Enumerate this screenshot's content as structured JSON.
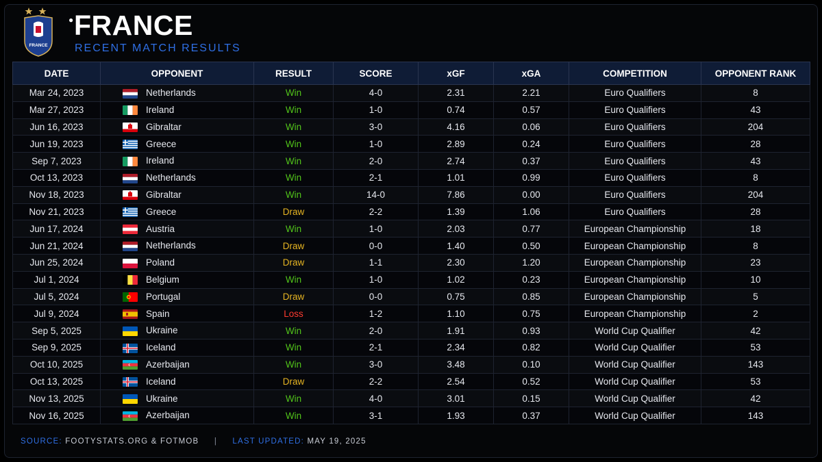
{
  "header": {
    "title": "FRANCE",
    "subtitle": "RECENT MATCH RESULTS",
    "crest_text": "FRANCE",
    "crest_stars": 2
  },
  "columns": [
    "DATE",
    "OPPONENT",
    "RESULT",
    "SCORE",
    "xGF",
    "xGA",
    "COMPETITION",
    "OPPONENT RANK"
  ],
  "rows": [
    {
      "date": "Mar 24, 2023",
      "opponent": "Netherlands",
      "flag": "netherlands-flag-icon",
      "result": "Win",
      "score": "4-0",
      "xgf": "2.31",
      "xga": "2.21",
      "competition": "Euro Qualifiers",
      "rank": "8"
    },
    {
      "date": "Mar 27, 2023",
      "opponent": "Ireland",
      "flag": "ireland-flag-icon",
      "result": "Win",
      "score": "1-0",
      "xgf": "0.74",
      "xga": "0.57",
      "competition": "Euro Qualifiers",
      "rank": "43"
    },
    {
      "date": "Jun 16, 2023",
      "opponent": "Gibraltar",
      "flag": "gibraltar-flag-icon",
      "result": "Win",
      "score": "3-0",
      "xgf": "4.16",
      "xga": "0.06",
      "competition": "Euro Qualifiers",
      "rank": "204"
    },
    {
      "date": "Jun 19, 2023",
      "opponent": "Greece",
      "flag": "greece-flag-icon",
      "result": "Win",
      "score": "1-0",
      "xgf": "2.89",
      "xga": "0.24",
      "competition": "Euro Qualifiers",
      "rank": "28"
    },
    {
      "date": "Sep 7, 2023",
      "opponent": "Ireland",
      "flag": "ireland-flag-icon",
      "result": "Win",
      "score": "2-0",
      "xgf": "2.74",
      "xga": "0.37",
      "competition": "Euro Qualifiers",
      "rank": "43"
    },
    {
      "date": "Oct 13, 2023",
      "opponent": "Netherlands",
      "flag": "netherlands-flag-icon",
      "result": "Win",
      "score": "2-1",
      "xgf": "1.01",
      "xga": "0.99",
      "competition": "Euro Qualifiers",
      "rank": "8"
    },
    {
      "date": "Nov 18, 2023",
      "opponent": "Gibraltar",
      "flag": "gibraltar-flag-icon",
      "result": "Win",
      "score": "14-0",
      "xgf": "7.86",
      "xga": "0.00",
      "competition": "Euro Qualifiers",
      "rank": "204"
    },
    {
      "date": "Nov 21, 2023",
      "opponent": "Greece",
      "flag": "greece-flag-icon",
      "result": "Draw",
      "score": "2-2",
      "xgf": "1.39",
      "xga": "1.06",
      "competition": "Euro Qualifiers",
      "rank": "28"
    },
    {
      "date": "Jun 17, 2024",
      "opponent": "Austria",
      "flag": "austria-flag-icon",
      "result": "Win",
      "score": "1-0",
      "xgf": "2.03",
      "xga": "0.77",
      "competition": "European Championship",
      "rank": "18"
    },
    {
      "date": "Jun 21, 2024",
      "opponent": "Netherlands",
      "flag": "netherlands-flag-icon",
      "result": "Draw",
      "score": "0-0",
      "xgf": "1.40",
      "xga": "0.50",
      "competition": "European Championship",
      "rank": "8"
    },
    {
      "date": "Jun 25, 2024",
      "opponent": "Poland",
      "flag": "poland-flag-icon",
      "result": "Draw",
      "score": "1-1",
      "xgf": "2.30",
      "xga": "1.20",
      "competition": "European Championship",
      "rank": "23"
    },
    {
      "date": "Jul 1, 2024",
      "opponent": "Belgium",
      "flag": "belgium-flag-icon",
      "result": "Win",
      "score": "1-0",
      "xgf": "1.02",
      "xga": "0.23",
      "competition": "European Championship",
      "rank": "10"
    },
    {
      "date": "Jul 5, 2024",
      "opponent": "Portugal",
      "flag": "portugal-flag-icon",
      "result": "Draw",
      "score": "0-0",
      "xgf": "0.75",
      "xga": "0.85",
      "competition": "European Championship",
      "rank": "5"
    },
    {
      "date": "Jul 9, 2024",
      "opponent": "Spain",
      "flag": "spain-flag-icon",
      "result": "Loss",
      "score": "1-2",
      "xgf": "1.10",
      "xga": "0.75",
      "competition": "European Championship",
      "rank": "2"
    },
    {
      "date": "Sep 5, 2025",
      "opponent": "Ukraine",
      "flag": "ukraine-flag-icon",
      "result": "Win",
      "score": "2-0",
      "xgf": "1.91",
      "xga": "0.93",
      "competition": "World Cup Qualifier",
      "rank": "42"
    },
    {
      "date": "Sep 9, 2025",
      "opponent": "Iceland",
      "flag": "iceland-flag-icon",
      "result": "Win",
      "score": "2-1",
      "xgf": "2.34",
      "xga": "0.82",
      "competition": "World Cup Qualifier",
      "rank": "53"
    },
    {
      "date": "Oct 10, 2025",
      "opponent": "Azerbaijan",
      "flag": "azerbaijan-flag-icon",
      "result": "Win",
      "score": "3-0",
      "xgf": "3.48",
      "xga": "0.10",
      "competition": "World Cup Qualifier",
      "rank": "143"
    },
    {
      "date": "Oct 13, 2025",
      "opponent": "Iceland",
      "flag": "iceland-flag-icon",
      "result": "Draw",
      "score": "2-2",
      "xgf": "2.54",
      "xga": "0.52",
      "competition": "World Cup Qualifier",
      "rank": "53"
    },
    {
      "date": "Nov 13, 2025",
      "opponent": "Ukraine",
      "flag": "ukraine-flag-icon",
      "result": "Win",
      "score": "4-0",
      "xgf": "3.01",
      "xga": "0.15",
      "competition": "World Cup Qualifier",
      "rank": "42"
    },
    {
      "date": "Nov 16, 2025",
      "opponent": "Azerbaijan",
      "flag": "azerbaijan-flag-icon",
      "result": "Win",
      "score": "3-1",
      "xgf": "1.93",
      "xga": "0.37",
      "competition": "World Cup Qualifier",
      "rank": "143"
    }
  ],
  "colors": {
    "win": "#52c41a",
    "draw": "#e6b422",
    "loss": "#ff3b30",
    "accent": "#2f6fe4",
    "header_bg": "#0f1c36"
  },
  "footer": {
    "source_label": "SOURCE:",
    "source_value": "FOOTYSTATS.ORG & FOTMOB",
    "separator": "|",
    "updated_label": "LAST UPDATED:",
    "updated_value": "MAY 19, 2025"
  }
}
